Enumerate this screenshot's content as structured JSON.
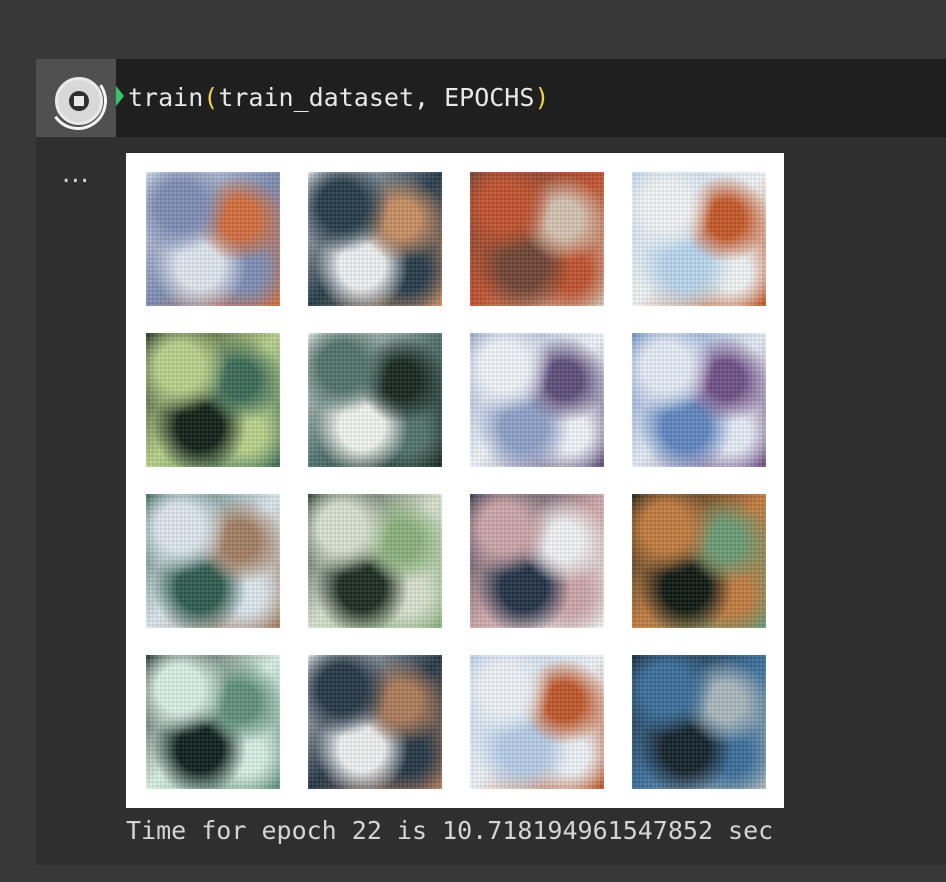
{
  "cell": {
    "code_fn": "train",
    "code_open": "(",
    "code_args": "train_dataset, EPOCHS",
    "code_close": ")",
    "output_menu": "...",
    "epoch_log": "Time for epoch 22 is 10.718194961547852 sec"
  },
  "colors": {
    "page_bg": "#383838",
    "cell_bg": "#2f2f2f",
    "code_bg": "#1f1f1f",
    "run_gutter": "#505050",
    "exec_marker": "#3ac46a",
    "paren": "#f1d04b"
  },
  "figure": {
    "tiles": [
      {
        "palette": "blue-white-rust",
        "colors": [
          "#dfe7ef",
          "#7d8db5",
          "#d56d3b"
        ]
      },
      {
        "palette": "white-blue-dark",
        "colors": [
          "#eef1f3",
          "#243a49",
          "#c88e63"
        ]
      },
      {
        "palette": "rust-brown",
        "colors": [
          "#6f4333",
          "#c0512d",
          "#d4c3b2"
        ]
      },
      {
        "palette": "blue-white-rust",
        "colors": [
          "#b9d6ee",
          "#f1f4f6",
          "#c55727"
        ]
      },
      {
        "palette": "green-black",
        "colors": [
          "#102116",
          "#b9d28b",
          "#3b6a56"
        ]
      },
      {
        "palette": "white-teal-dark",
        "colors": [
          "#f2f4ee",
          "#51726d",
          "#16261f"
        ]
      },
      {
        "palette": "blue-purple",
        "colors": [
          "#8da1c8",
          "#f1f5fb",
          "#5d4d7a"
        ]
      },
      {
        "palette": "blue-purple",
        "colors": [
          "#5f86c1",
          "#e7edf7",
          "#6f4f86"
        ]
      },
      {
        "palette": "teal-white",
        "colors": [
          "#2d5b4f",
          "#dce7ee",
          "#a37e63"
        ]
      },
      {
        "palette": "green-white",
        "colors": [
          "#1a2c1f",
          "#d8e2cf",
          "#8ab27c"
        ]
      },
      {
        "palette": "navy-pink",
        "colors": [
          "#223047",
          "#cda5a8",
          "#f0f3f4"
        ]
      },
      {
        "palette": "dark-green-orange",
        "colors": [
          "#0e1711",
          "#c27b3f",
          "#6a9a73"
        ]
      },
      {
        "palette": "green-white",
        "colors": [
          "#0d1f1b",
          "#d9f0e5",
          "#5f8f7c"
        ]
      },
      {
        "palette": "white-navy-brown",
        "colors": [
          "#eef0f1",
          "#243646",
          "#ae7b5a"
        ]
      },
      {
        "palette": "blue-white-orange",
        "colors": [
          "#b5cde8",
          "#eef3f8",
          "#c05628"
        ]
      },
      {
        "palette": "dark-blue-teal",
        "colors": [
          "#12212a",
          "#3a6e9b",
          "#a8b7bc"
        ]
      }
    ]
  }
}
